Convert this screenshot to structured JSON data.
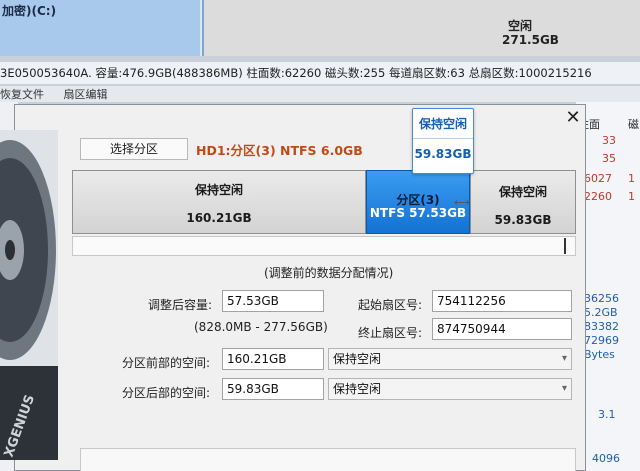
{
  "background": {
    "partition_strip_label": "加密)(C:)",
    "free_block": {
      "label": "空闲",
      "size": "271.5GB"
    },
    "disk_info": "3E050053640A. 容量:476.9GB(488386MB) 柱面数:62260 磁头数:255 每道扇区数:63 总扇区数:1000215216",
    "menu": [
      "恢复文件",
      "扇区编辑"
    ],
    "right_column": {
      "header": "柱面",
      "header_partial": "磁",
      "values_top": [
        "33",
        "35",
        "6027",
        "2260"
      ],
      "markers": [
        "1",
        "1"
      ],
      "values_mid": [
        "36256",
        "5.2GB",
        "83382",
        "72969",
        "Bytes"
      ],
      "value_31": "3.1",
      "value_4096": "4096"
    },
    "brand_text": "XGENIUS"
  },
  "dialog": {
    "close_label": "✕",
    "select_partition_label": "选择分区",
    "selected_partition": "HD1:分区(3) NTFS 6.0GB",
    "bar": {
      "before": {
        "label": "保持空闲",
        "size": "160.21GB"
      },
      "partition": {
        "label": "分区(3)",
        "detail": "NTFS 57.53GB"
      },
      "after": {
        "label": "保持空闲",
        "size": "59.83GB"
      },
      "resize_indicator": "⟷"
    },
    "tooltip": {
      "title": "保持空闲",
      "size": "59.83GB"
    },
    "distribution_caption": "(调整前的数据分配情况)",
    "fields": {
      "resized_capacity_label": "调整后容量:",
      "resized_capacity_value": "57.53GB",
      "range": "(828.0MB - 277.56GB)",
      "start_sector_label": "起始扇区号:",
      "start_sector_value": "754112256",
      "end_sector_label": "终止扇区号:",
      "end_sector_value": "874750944",
      "space_before_label": "分区前部的空间:",
      "space_before_value": "160.21GB",
      "space_before_option": "保持空闲",
      "space_after_label": "分区后部的空间:",
      "space_after_value": "59.83GB",
      "space_after_option": "保持空闲"
    }
  },
  "colors": {
    "accent_blue": "#1472d2",
    "selected_partition_text": "#c14a14",
    "tooltip_text": "#1460b0",
    "right_column_red": "#c0392b",
    "right_column_blue": "#1f5fae"
  }
}
